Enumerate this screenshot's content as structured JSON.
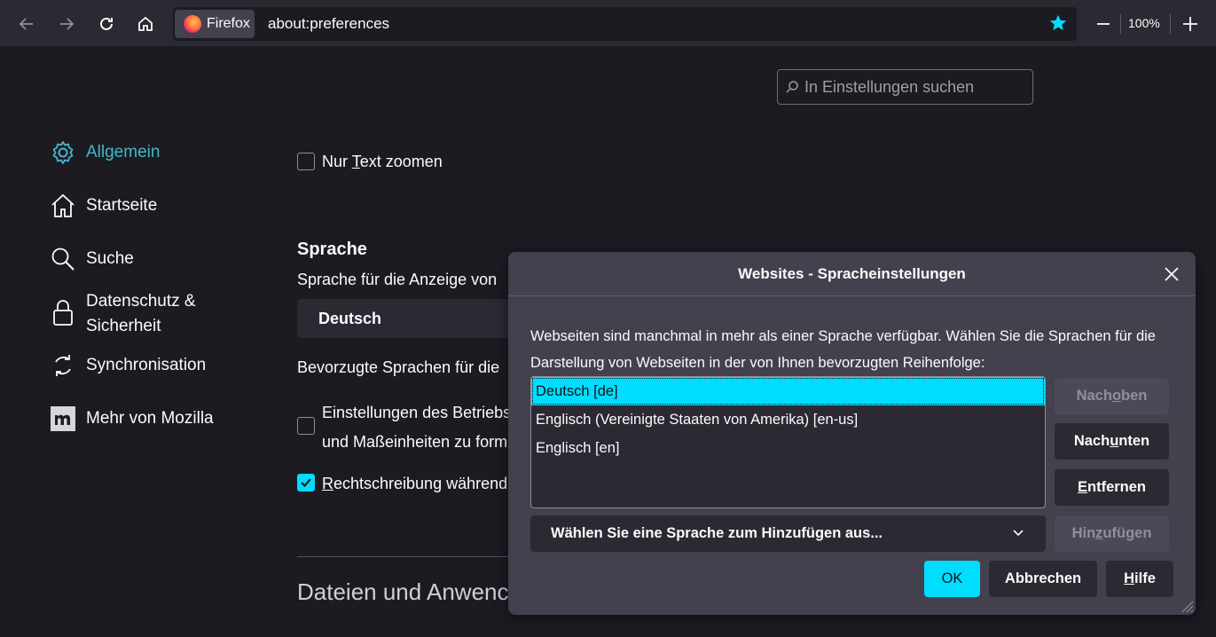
{
  "browser": {
    "identity_label": "Firefox",
    "url": "about:preferences",
    "zoom": "100%"
  },
  "search": {
    "placeholder": "In Einstellungen suchen"
  },
  "sidebar": {
    "items": [
      {
        "label": "Allgemein",
        "icon": "gear-icon",
        "active": true
      },
      {
        "label": "Startseite",
        "icon": "home-icon"
      },
      {
        "label": "Suche",
        "icon": "search-icon"
      },
      {
        "label": "Datenschutz &",
        "label2": "Sicherheit",
        "icon": "lock-icon"
      },
      {
        "label": "Synchronisation",
        "icon": "sync-icon"
      },
      {
        "label": "Mehr von Mozilla",
        "icon": "mozilla-icon"
      }
    ]
  },
  "main": {
    "zoom_text_label_pre": "Nur ",
    "zoom_text_label_u": "T",
    "zoom_text_label_post": "ext zoomen",
    "language_heading": "Sprache",
    "language_desc": "Sprache für die Anzeige von",
    "language_value": "Deutsch",
    "preferred_langs": "Bevorzugte Sprachen für die",
    "os_settings_line1": "Einstellungen des Betriebs",
    "os_settings_line2": "und Maßeinheiten zu form",
    "spellcheck_u": "R",
    "spellcheck_rest": "echtschreibung während",
    "files_heading": "Dateien und Anwenc"
  },
  "dialog": {
    "title": "Websites - Spracheinstellungen",
    "description": "Webseiten sind manchmal in mehr als einer Sprache verfügbar. Wählen Sie die Sprachen für die Darstellung von Webseiten in der von Ihnen bevorzugten Reihenfolge:",
    "languages": [
      "Deutsch  [de]",
      "Englisch (Vereinigte Staaten von Amerika)  [en-us]",
      "Englisch  [en]"
    ],
    "btn_up_pre": "Nach ",
    "btn_up_u": "o",
    "btn_up_post": "ben",
    "btn_down_pre": "Nach ",
    "btn_down_u": "u",
    "btn_down_post": "nten",
    "btn_remove_u": "E",
    "btn_remove_post": "ntfernen",
    "add_select_label": "Wählen Sie eine Sprache zum Hinzufügen aus...",
    "btn_add_pre": "Hin",
    "btn_add_u": "z",
    "btn_add_post": "ufügen",
    "btn_ok": "OK",
    "btn_cancel": "Abbrechen",
    "btn_help_u": "H",
    "btn_help_post": "ilfe"
  },
  "colors": {
    "accent": "#00ddff",
    "background": "#1c1b22",
    "toolbar": "#2b2a33",
    "dialog": "#42414d"
  }
}
